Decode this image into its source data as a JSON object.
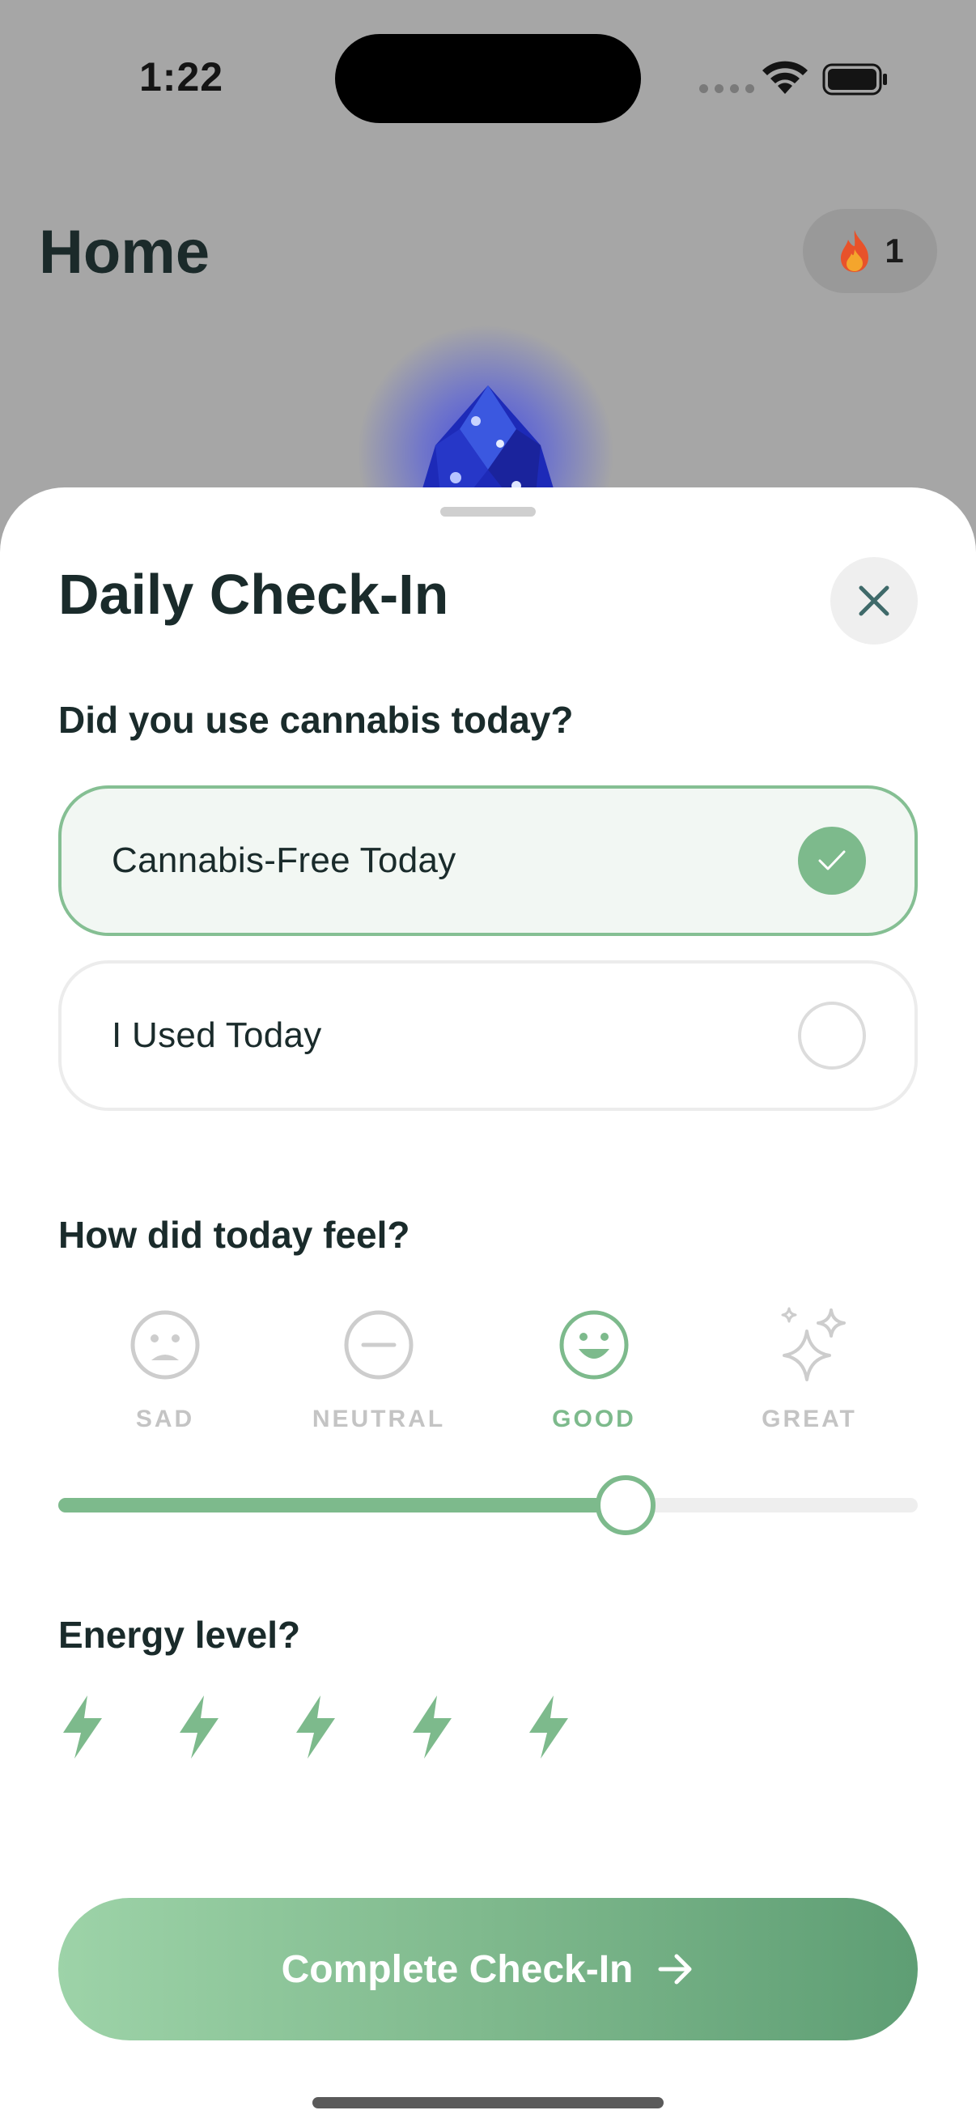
{
  "status_bar": {
    "time": "1:22"
  },
  "background_page": {
    "title": "Home",
    "streak_count": "1"
  },
  "sheet": {
    "title": "Daily Check-In",
    "usage_question": "Did you use cannabis today?",
    "usage_options": [
      {
        "label": "Cannabis-Free Today",
        "selected": true
      },
      {
        "label": "I Used Today",
        "selected": false
      }
    ],
    "mood_question": "How did today feel?",
    "moods": [
      {
        "label": "SAD",
        "icon": "sad-face-icon",
        "active": false
      },
      {
        "label": "NEUTRAL",
        "icon": "neutral-face-icon",
        "active": false
      },
      {
        "label": "GOOD",
        "icon": "happy-face-icon",
        "active": true
      },
      {
        "label": "GREAT",
        "icon": "sparkles-icon",
        "active": false
      }
    ],
    "mood_slider_value": 0.66,
    "energy_question": "Energy level?",
    "energy_level": 5,
    "energy_max": 5,
    "submit_label": "Complete Check-In"
  },
  "colors": {
    "accent": "#7dba8c",
    "title_text": "#1a2b2b",
    "overlay": "#a6a6a6"
  }
}
